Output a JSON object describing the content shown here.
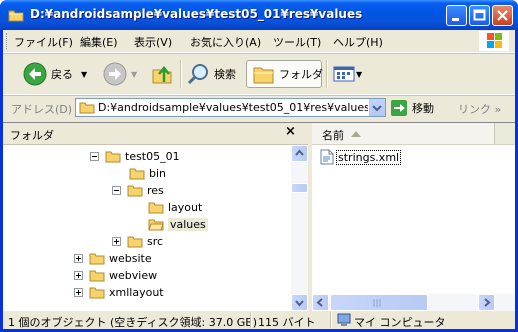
{
  "window": {
    "title": "D:¥androidsample¥values¥test05_01¥res¥values"
  },
  "menu": {
    "items": [
      "ファイル(F)",
      "編集(E)",
      "表示(V)",
      "お気に入り(A)",
      "ツール(T)",
      "ヘルプ(H)"
    ]
  },
  "toolbar": {
    "back_label": "戻る",
    "search_label": "検索",
    "folders_label": "フォルダ"
  },
  "address": {
    "label": "アドレス(D)",
    "value": "D:¥androidsample¥values¥test05_01¥res¥values",
    "go_label": "移動",
    "links_label": "リンク"
  },
  "tree": {
    "header": "フォルダ",
    "close_glyph": "×",
    "nodes": [
      {
        "label": "test05_01",
        "expander": "minus"
      },
      {
        "label": "bin",
        "expander": "none"
      },
      {
        "label": "res",
        "expander": "minus"
      },
      {
        "label": "layout",
        "expander": "none"
      },
      {
        "label": "values",
        "expander": "none",
        "selected": true
      },
      {
        "label": "src",
        "expander": "plus"
      },
      {
        "label": "website",
        "expander": "plus"
      },
      {
        "label": "webview",
        "expander": "plus"
      },
      {
        "label": "xmllayout",
        "expander": "plus"
      }
    ]
  },
  "list": {
    "column_name": "名前",
    "files": [
      {
        "name": "strings.xml"
      }
    ]
  },
  "status": {
    "objects": "1 個のオブジェクト (空きディスク領域: 37.0 GB)",
    "size": "115 バイト",
    "location": "マイ コンピュータ"
  },
  "colors": {
    "titlebar": "#0054e3",
    "chrome": "#ece9d8",
    "folder": "#f6d36b"
  },
  "icons": {
    "window": "folder-icon",
    "back": "back-arrow-icon",
    "forward": "forward-arrow-icon",
    "up": "up-folder-icon",
    "search": "search-icon",
    "folders": "folders-icon",
    "views": "views-icon",
    "go": "go-arrow-icon",
    "file": "xml-file-icon",
    "computer": "my-computer-icon"
  }
}
